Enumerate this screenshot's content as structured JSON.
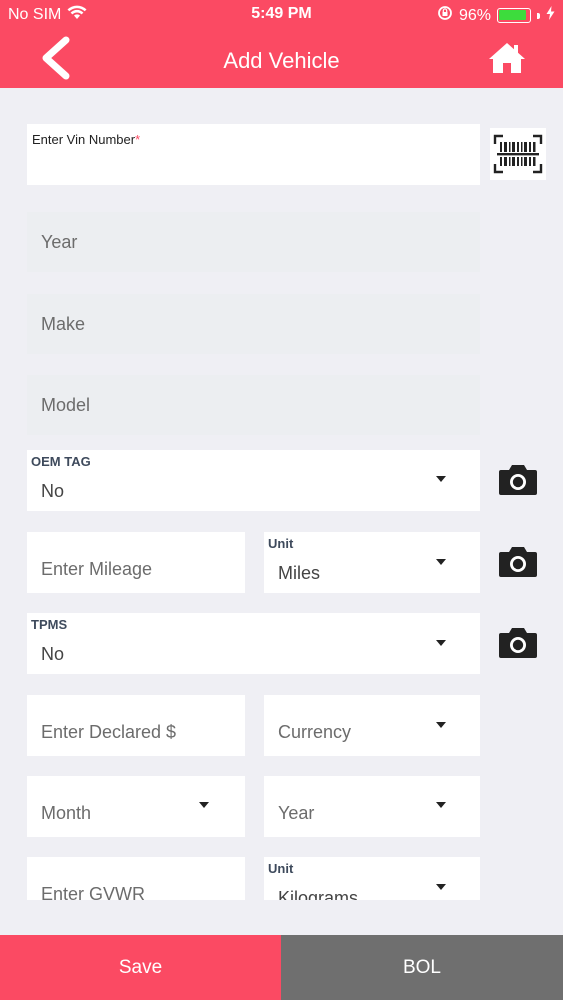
{
  "status_bar": {
    "carrier": "No SIM",
    "time": "5:49 PM",
    "battery": "96%",
    "battery_level": 0.96,
    "icons": [
      "wifi-icon",
      "rotation-lock-icon",
      "battery-icon",
      "charging-bolt-icon"
    ]
  },
  "header": {
    "title": "Add Vehicle",
    "back_icon": "chevron-left-icon",
    "home_icon": "home-icon",
    "color": "#fb4a63"
  },
  "form": {
    "vin": {
      "label": "Enter Vin Number",
      "required_mark": "*",
      "value": "",
      "scan_icon": "barcode-scan-icon"
    },
    "year": {
      "placeholder": "Year"
    },
    "make": {
      "placeholder": "Make"
    },
    "model": {
      "placeholder": "Model"
    },
    "oem_tag": {
      "label": "OEM TAG",
      "value": "No"
    },
    "mileage": {
      "placeholder": "Enter Mileage"
    },
    "mileage_unit": {
      "label": "Unit",
      "value": "Miles"
    },
    "tpms": {
      "label": "TPMS",
      "value": "No"
    },
    "declared": {
      "placeholder": "Enter Declared $"
    },
    "currency": {
      "placeholder": "Currency"
    },
    "month": {
      "placeholder": "Month"
    },
    "year_select": {
      "placeholder": "Year"
    },
    "gvwr": {
      "placeholder": "Enter GVWR"
    },
    "gvwr_unit": {
      "label": "Unit",
      "value": "Kilograms"
    },
    "camera_icon": "camera-icon"
  },
  "footer": {
    "save_label": "Save",
    "bol_label": "BOL",
    "save_color": "#fb4a63",
    "bol_color": "#6f6f6f"
  }
}
